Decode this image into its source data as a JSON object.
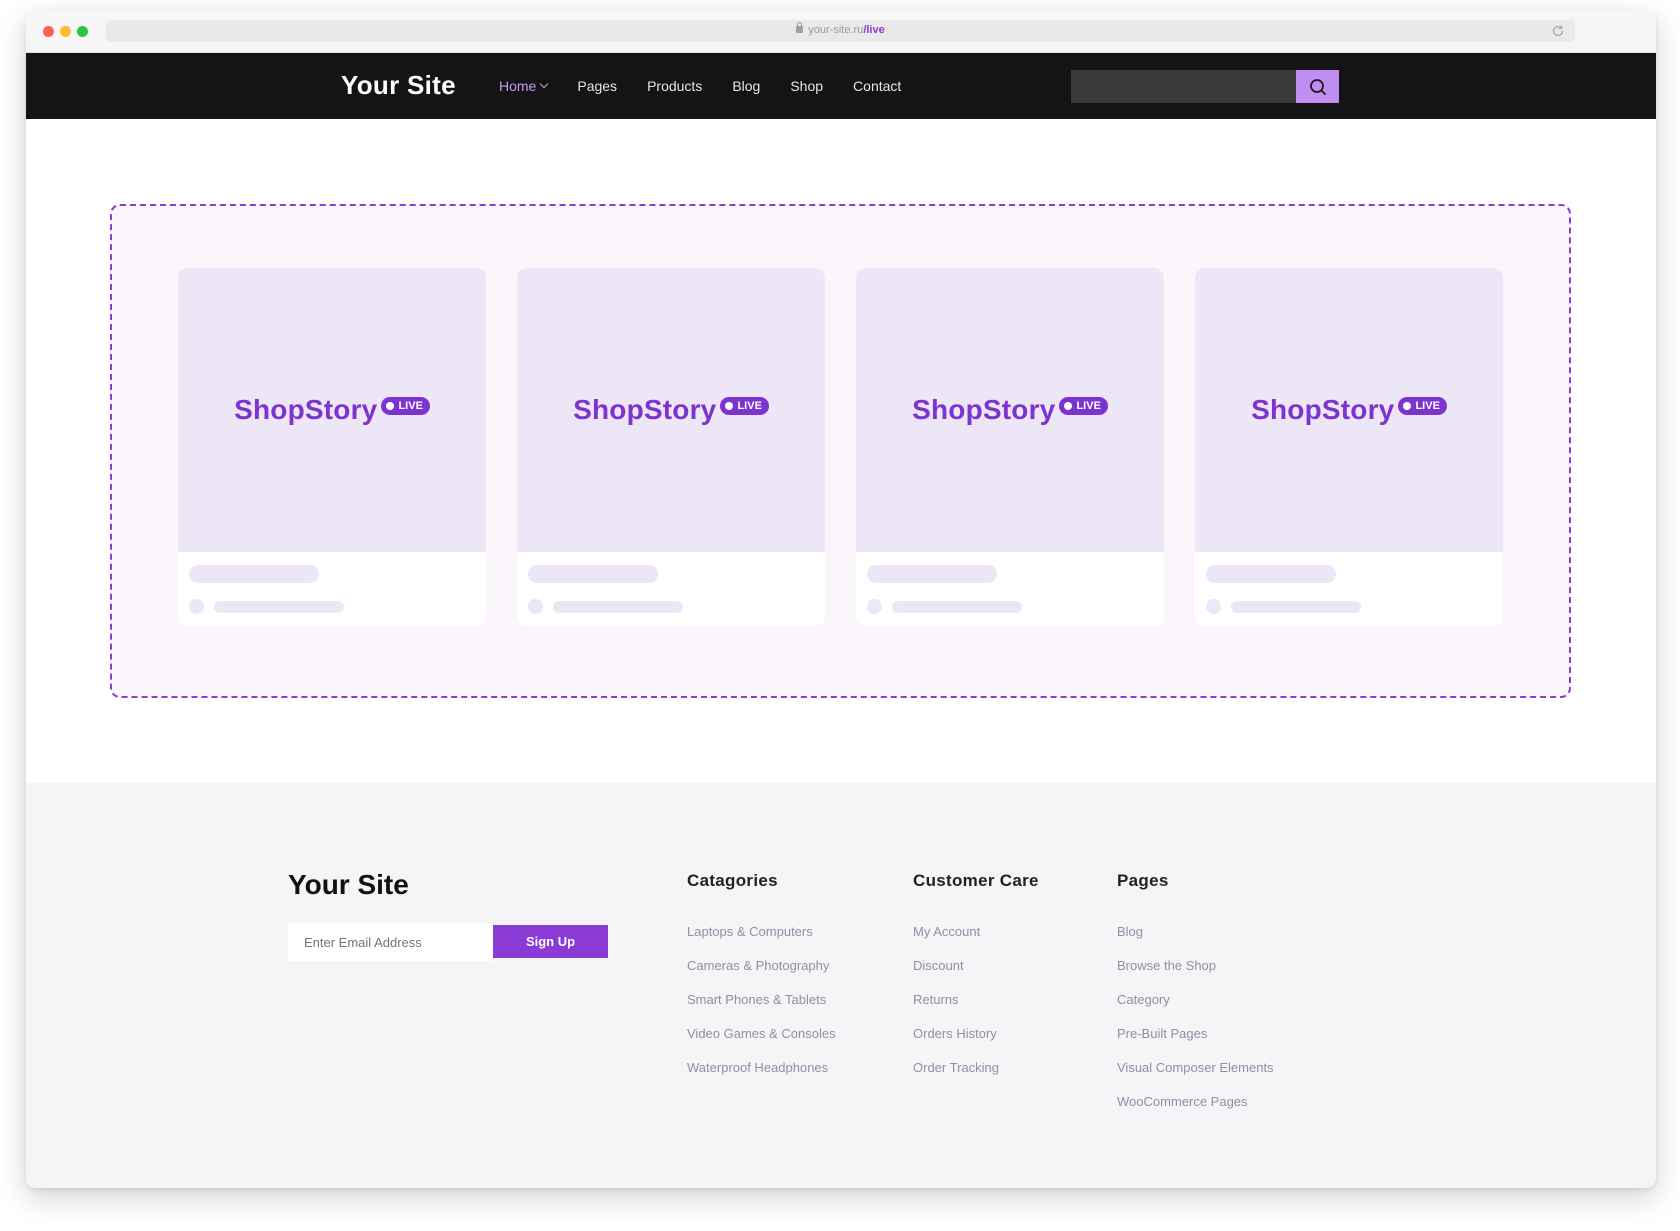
{
  "browser": {
    "url_domain": "your-site.ru",
    "url_path": "/live"
  },
  "header": {
    "logo": "Your Site",
    "nav": [
      "Home",
      "Pages",
      "Products",
      "Blog",
      "Shop",
      "Contact"
    ],
    "search_placeholder": ""
  },
  "main": {
    "cards": [
      {
        "brand": "ShopStory",
        "badge": "LIVE"
      },
      {
        "brand": "ShopStory",
        "badge": "LIVE"
      },
      {
        "brand": "ShopStory",
        "badge": "LIVE"
      },
      {
        "brand": "ShopStory",
        "badge": "LIVE"
      }
    ]
  },
  "footer": {
    "logo": "Your Site",
    "email_placeholder": "Enter Email Address",
    "signup_label": "Sign Up",
    "columns": [
      {
        "title": "Catagories",
        "links": [
          "Laptops & Computers",
          "Cameras & Photography",
          "Smart Phones & Tablets",
          "Video Games & Consoles",
          "Waterproof Headphones"
        ]
      },
      {
        "title": "Customer Care",
        "links": [
          "My Account",
          "Discount",
          "Returns",
          "Orders History",
          "Order Tracking"
        ]
      },
      {
        "title": "Pages",
        "links": [
          "Blog",
          "Browse the Shop",
          "Category",
          "Pre-Built Pages",
          "Visual Composer Elements",
          "WooCommerce Pages"
        ]
      }
    ]
  },
  "colors": {
    "accent": "#8b3ad4",
    "header_bg": "#141414",
    "nav_active": "#c69cf5",
    "search_button": "#c08df2",
    "card_image_bg": "#ece6f6",
    "dashed_area_bg": "#fbf6fc",
    "footer_bg": "#f5f5f8"
  },
  "icons": {
    "search_button": "search-icon",
    "browser_reload": "reload-icon",
    "url_lock": "lock-icon"
  }
}
